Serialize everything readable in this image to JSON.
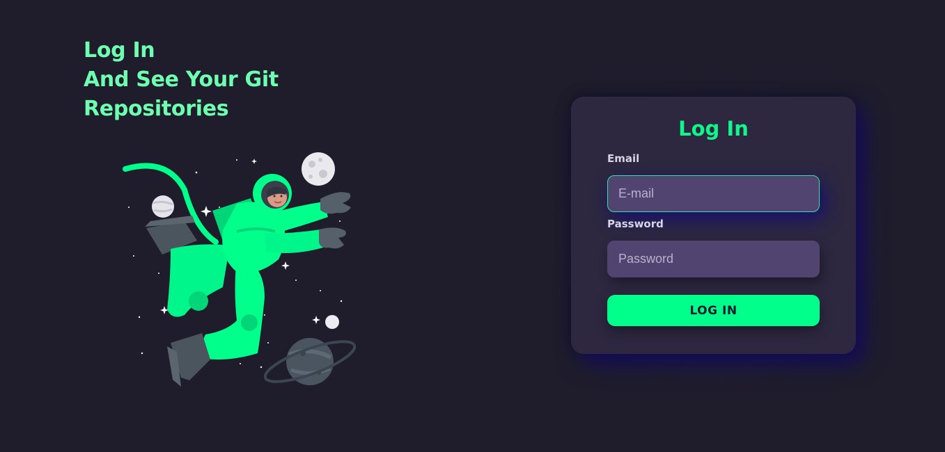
{
  "hero": {
    "line1": "Log In",
    "line2": "And See Your Git",
    "line3": "Repositories"
  },
  "illustration": {
    "icon": "astronaut-floating-in-space-illustration"
  },
  "login_card": {
    "title": "Log In",
    "email_label": "Email",
    "email_placeholder": "E-mail",
    "email_value": "",
    "password_label": "Password",
    "password_placeholder": "Password",
    "password_value": "",
    "submit_label": "LOG IN"
  },
  "colors": {
    "background": "#1f1d2b",
    "accent_green": "#00ff8b",
    "headline_green": "#6effb1",
    "card": "#2d2840",
    "input": "#514470",
    "glow": "#0f056e"
  }
}
